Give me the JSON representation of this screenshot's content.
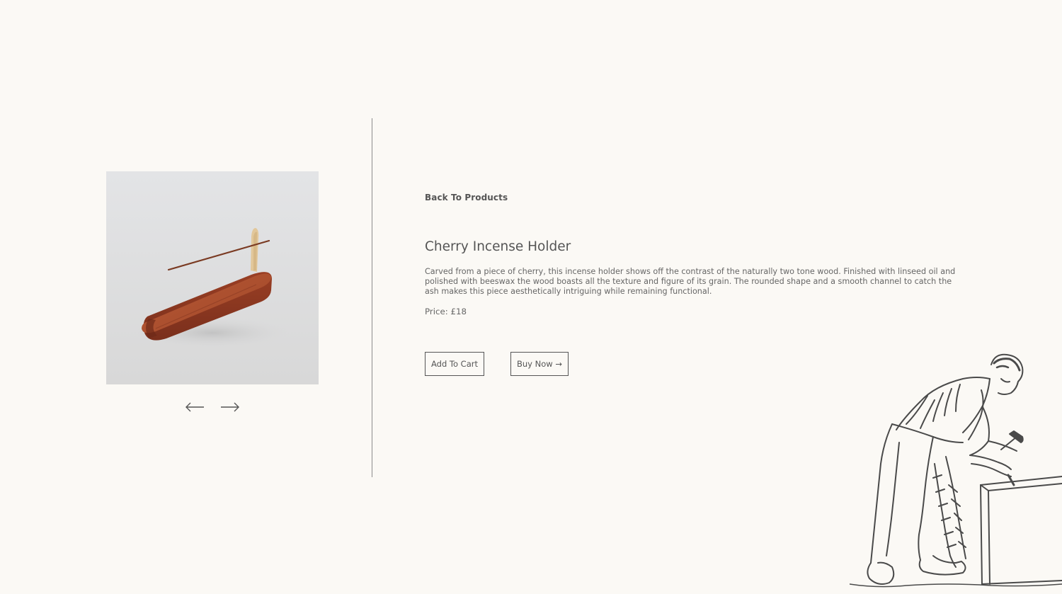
{
  "gallery": {
    "image_alt": "Cherry incense holder photo",
    "prev_icon": "arrow-left-icon",
    "next_icon": "arrow-right-icon"
  },
  "details": {
    "back_label": "Back To Products",
    "title": "Cherry Incense Holder",
    "description": "Carved from a piece of cherry, this incense holder shows off the contrast of the naturally two tone wood. Finished with linseed oil and polished with beeswax the wood boasts all the texture and figure of its grain. The rounded shape and a smooth channel to catch the ash makes this piece aesthetically intriguing while remaining functional.",
    "price_label": "Price: £18"
  },
  "actions": {
    "add_to_cart_label": "Add To Cart",
    "buy_now_label": "Buy Now →"
  },
  "colors": {
    "background": "#fbf9f5",
    "text": "#555555",
    "wood": "#a0482a"
  },
  "decor": {
    "illustration": "carpenter-illustration"
  }
}
